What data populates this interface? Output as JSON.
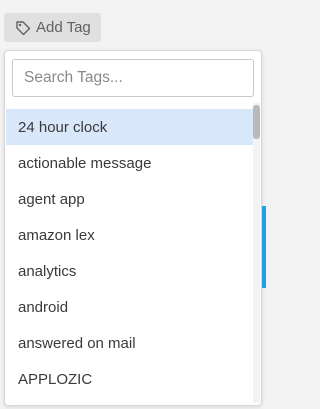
{
  "add_tag_button": {
    "label": "Add Tag",
    "icon": "tag-icon"
  },
  "tag_dropdown": {
    "search": {
      "placeholder": "Search Tags...",
      "value": ""
    },
    "selected_index": 0,
    "items": [
      {
        "label": "24 hour clock"
      },
      {
        "label": "actionable message"
      },
      {
        "label": "agent app"
      },
      {
        "label": "amazon lex"
      },
      {
        "label": "analytics"
      },
      {
        "label": "android"
      },
      {
        "label": "answered on mail"
      },
      {
        "label": "APPLOZIC"
      }
    ]
  },
  "colors": {
    "selected_item_bg": "#d9e7fb",
    "button_bg": "#e0e0e0",
    "accent": "#1fa2e0"
  }
}
